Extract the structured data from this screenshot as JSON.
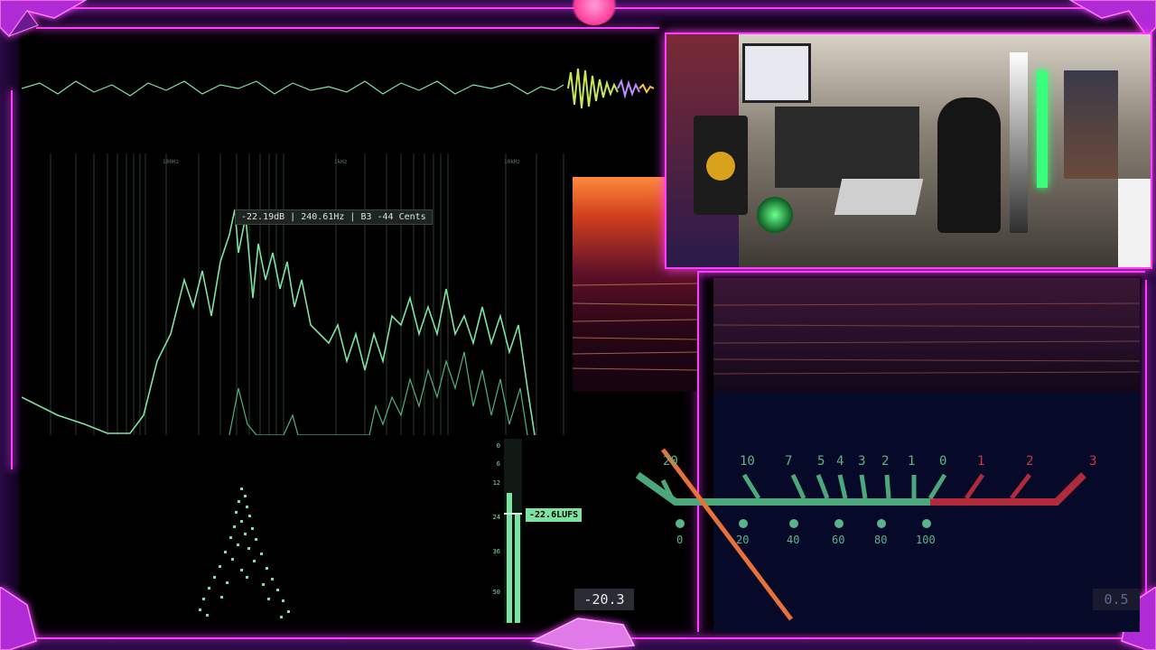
{
  "spectrum": {
    "frequency_labels": [
      "100Hz",
      "1kHz",
      "10kHz"
    ],
    "tooltip": "-22.19dB | 240.61Hz | B3  -44 Cents"
  },
  "loudness_meter": {
    "ticks": [
      "0",
      "6",
      "12",
      "24",
      "36",
      "50"
    ],
    "lufs_badge": "-22.6LUFS",
    "readout": "-20.3"
  },
  "vu_meter": {
    "scale_db": [
      "20",
      "10",
      "7",
      "5",
      "4",
      "3",
      "2",
      "1",
      "0",
      "1",
      "2",
      "3"
    ],
    "scale_percent": [
      "0",
      "20",
      "40",
      "60",
      "80",
      "100"
    ],
    "readout": "0.5"
  },
  "colors": {
    "accent_green": "#7de3a0",
    "neon_pink": "#ff3cff",
    "vu_red": "#c9374a",
    "background": "#000000"
  }
}
